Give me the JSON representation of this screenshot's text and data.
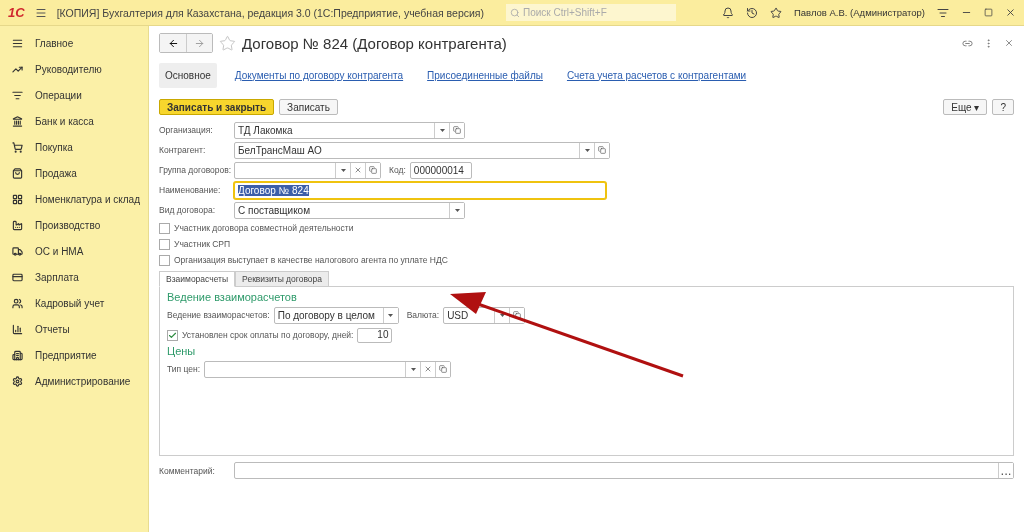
{
  "app_bar": {
    "logo": "1С",
    "title": "[КОПИЯ] Бухгалтерия для Казахстана, редакция 3.0  (1С:Предприятие, учебная версия)",
    "search": {
      "placeholder": "Поиск Ctrl+Shift+F"
    },
    "user": "Павлов А.В. (Администратор)"
  },
  "sidebar": {
    "items": [
      {
        "label": "Главное"
      },
      {
        "label": "Руководителю"
      },
      {
        "label": "Операции"
      },
      {
        "label": "Банк и касса"
      },
      {
        "label": "Покупка"
      },
      {
        "label": "Продажа"
      },
      {
        "label": "Номенклатура и склад"
      },
      {
        "label": "Производство"
      },
      {
        "label": "ОС и НМА"
      },
      {
        "label": "Зарплата"
      },
      {
        "label": "Кадровый учет"
      },
      {
        "label": "Отчеты"
      },
      {
        "label": "Предприятие"
      },
      {
        "label": "Администрирование"
      }
    ]
  },
  "form": {
    "title": "Договор № 824 (Договор контрагента)",
    "favorite": false,
    "nav_tabs": [
      {
        "label": "Основное",
        "selected": true
      },
      {
        "label": "Документы по договору контрагента",
        "selected": false
      },
      {
        "label": "Присоединенные файлы",
        "selected": false
      },
      {
        "label": "Счета учета расчетов с контрагентами",
        "selected": false
      }
    ],
    "buttons": [
      {
        "label": "Записать и закрыть",
        "primary": true
      },
      {
        "label": "Записать",
        "primary": false
      }
    ],
    "more_button": "Еще ▾",
    "help_button": "?",
    "fields": [
      {
        "label": "Организация:",
        "value": "ТД Лакомка"
      },
      {
        "label": "Контрагент:",
        "value": "БелТрансМаш АО"
      },
      {
        "label": "Группа договоров:",
        "extra": {
          "label": "Код:",
          "value": "000000014"
        }
      },
      {
        "label": "Наименование:",
        "value": "Договор № 824",
        "focused": true
      },
      {
        "label": "Вид договора:",
        "value": "С поставщиком"
      }
    ],
    "checkboxes": [
      {
        "label": "Участник договора совместной деятельности",
        "checked": false
      },
      {
        "label": "Участник СРП",
        "checked": false
      },
      {
        "label": "Организация выступает в качестве налогового агента по уплате НДС",
        "checked": false
      }
    ],
    "tabs": [
      {
        "label": "Взаиморасчеты",
        "selected": true
      },
      {
        "label": "Реквизиты договора",
        "selected": false
      }
    ],
    "settlements": {
      "heading": "Ведение взаиморасчетов",
      "mode_label": "Ведение взаиморасчетов:",
      "mode_value": "По договору в целом",
      "currency_label": "Валюта:",
      "currency_value": "USD",
      "term": {
        "label": "Установлен срок оплаты по договору, дней:",
        "checked": true,
        "value": "10"
      }
    },
    "prices": {
      "heading": "Цены",
      "label": "Тип цен:"
    },
    "comment": {
      "label": "Комментарий:",
      "button": "..."
    }
  }
}
